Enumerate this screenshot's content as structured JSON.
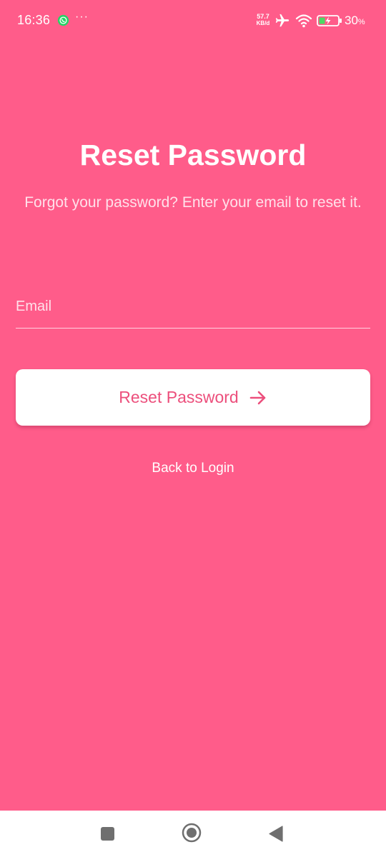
{
  "status_bar": {
    "time": "16:36",
    "more": "···",
    "net_speed_value": "57.7",
    "net_speed_unit": "KB/d",
    "battery_level": "30",
    "battery_unit": "%",
    "icons": [
      "whatsapp-icon",
      "airplane-mode-icon",
      "wifi-icon",
      "battery-charging-icon"
    ]
  },
  "page": {
    "title": "Reset Password",
    "subtitle": "Forgot your password? Enter your email to reset it."
  },
  "form": {
    "email_placeholder": "Email",
    "email_value": "",
    "submit_label": "Reset Password",
    "submit_icon": "arrow-right-icon"
  },
  "links": {
    "back_to_login": "Back to Login"
  },
  "nav_bar": {
    "icons": [
      "recent-apps-icon",
      "home-icon",
      "back-icon"
    ]
  },
  "colors": {
    "background": "#ff5c8a",
    "button_background": "#ffffff",
    "button_text": "#ec4f7c",
    "text_primary": "#ffffff"
  }
}
